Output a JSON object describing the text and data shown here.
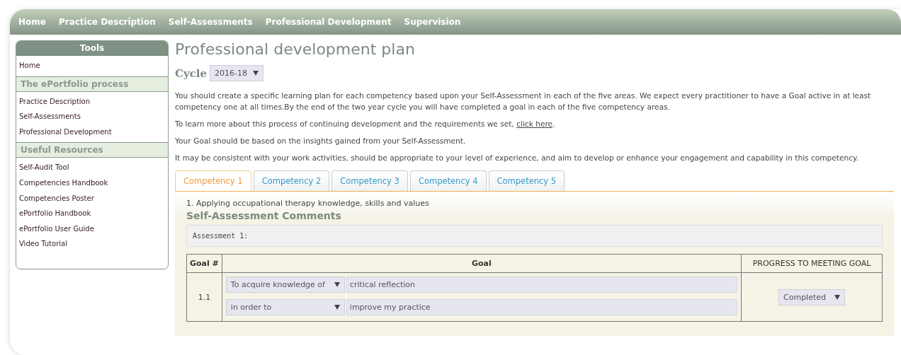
{
  "nav": [
    {
      "label": "Home"
    },
    {
      "label": "Practice Description"
    },
    {
      "label": "Self-Assessments"
    },
    {
      "label": "Professional Development"
    },
    {
      "label": "Supervision"
    }
  ],
  "sidebar": {
    "title": "Tools",
    "sections": [
      {
        "items": [
          "Home"
        ]
      },
      {
        "heading": "The ePortfolio process",
        "items": [
          "Practice Description",
          "Self-Assessments",
          "Professional Development"
        ]
      },
      {
        "heading": "Useful Resources",
        "items": [
          "Self-Audit Tool",
          "Competencies Handbook",
          "Competencies Poster",
          "ePortfolio Handbook",
          "ePortfolio User Guide",
          "Video Tutorial"
        ]
      }
    ]
  },
  "page_title": "Professional development plan",
  "cycle": {
    "label": "Cycle",
    "value": "2016-18"
  },
  "paragraphs": [
    {
      "text": "You should create a specific learning plan for each competency based upon your Self-Assessment in each of the five areas. We expect every practitioner to have a Goal active in at least competency one at all times.By the end of the two year cycle you will have completed a goal in each of the five competency areas."
    },
    {
      "text": "To learn more about this process of continuing development and the requirements we set, ",
      "link": "click here",
      "after": "."
    },
    {
      "text": "Your Goal should be based on the insights gained from your Self-Assessment."
    },
    {
      "text": "It may be consistent with your work activities, should be appropriate to your level of experience, and aim to develop or enhance your engagement and capability in this competency."
    }
  ],
  "tabs": [
    {
      "label": "Competency 1",
      "selected": true
    },
    {
      "label": "Competency 2",
      "selected": false
    },
    {
      "label": "Competency 3",
      "selected": false
    },
    {
      "label": "Competency 4",
      "selected": false
    },
    {
      "label": "Competency 5",
      "selected": false
    }
  ],
  "competency_title": "1. Applying occupational therapy knowledge, skills and values",
  "comments_heading": "Self-Assessment Comments",
  "comments": "Assessment 1:",
  "goal_table": {
    "columns": [
      "Goal #",
      "Goal",
      "PROGRESS TO MEETING GOAL"
    ],
    "rows": [
      {
        "number": "1.1",
        "lines": [
          {
            "select": "To acquire knowledge of",
            "value": "critical reflection"
          },
          {
            "select": "in order to",
            "value": "improve my practice"
          }
        ],
        "progress": "Completed"
      }
    ]
  }
}
